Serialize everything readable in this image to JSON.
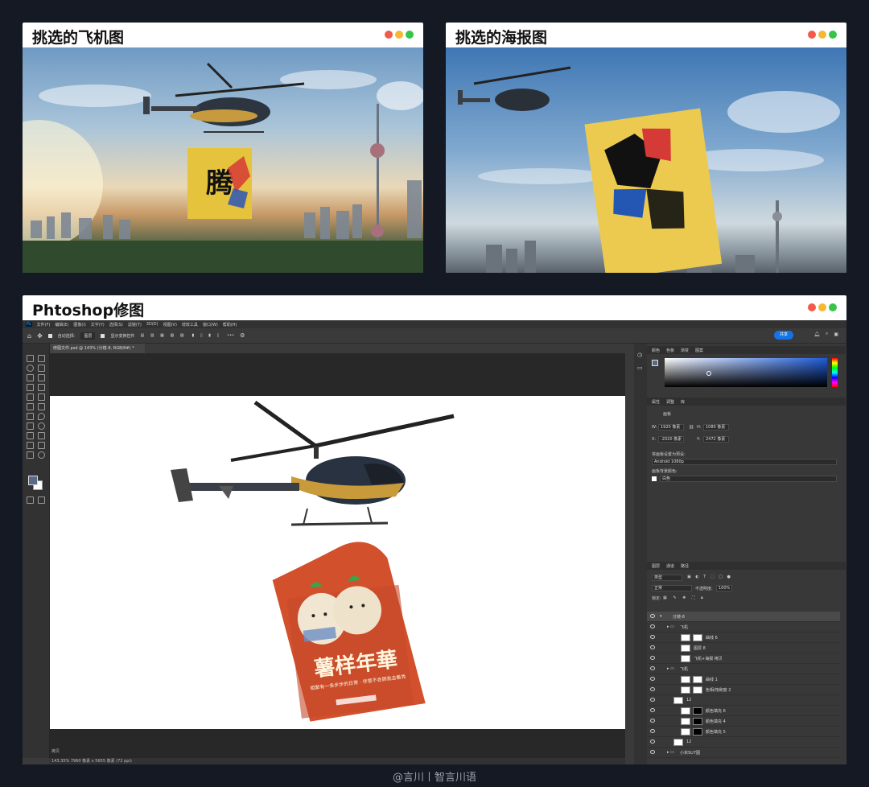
{
  "cards": {
    "heli_title": "挑选的飞机图",
    "poster_title": "挑选的海报图",
    "ps_title": "Phtoshop修图"
  },
  "window_dot_colors": [
    "#f25a4a",
    "#f6b731",
    "#37c44a"
  ],
  "poster_artwork": {
    "headline": "薯样年華",
    "subline": "相聚有一条步步的日常 · 伴意不会顾我去看秀"
  },
  "ps": {
    "menu": [
      "Ps",
      "文件(F)",
      "编辑(E)",
      "图像(I)",
      "文字(Y)",
      "选择(S)",
      "滤镜(T)",
      "3D(D)",
      "视图(V)",
      "增效工具",
      "窗口(W)",
      "帮助(H)"
    ],
    "options": {
      "auto_select": "自动选择:",
      "layer_select": "图层",
      "transform_controls": "显示变换控件"
    },
    "share_label": "共享",
    "doc_tab": "修图文件.psd @ 143% (分镜-8, RGB/8#) *",
    "status_left": "143.35%   7960 像素 x 5655 像素 (72 ppi)",
    "bottom_label": "拷贝",
    "color_panel_tabs": [
      "颜色",
      "色板",
      "渐变",
      "图案"
    ],
    "props_tabs": [
      "属性",
      "调整",
      "库"
    ],
    "props": {
      "artboard_label": "画板",
      "w_label": "W:",
      "w_value": "1920 像素",
      "h_label": "H:",
      "h_value": "1080 像素",
      "x_label": "X:",
      "x_value": "-2020 像素",
      "y_label": "Y:",
      "y_value": "2472 像素",
      "preset_label": "将画板设置为预设:",
      "preset_value": "Android 1080p",
      "bg_label": "画板背景颜色:",
      "bg_value": "白色"
    },
    "layers_tabs": [
      "图层",
      "通道",
      "路径"
    ],
    "layers_filter": "类型",
    "blend_mode": "正常",
    "opacity_label": "不透明度:",
    "opacity_value": "100%",
    "lock_label": "锁定:",
    "layers": [
      {
        "name": "分镜-8",
        "indent": 0,
        "kind": "artboard"
      },
      {
        "name": "飞机",
        "indent": 1,
        "kind": "folder"
      },
      {
        "name": "曲线 6",
        "indent": 2,
        "kind": "adjust"
      },
      {
        "name": "图层 8",
        "indent": 2,
        "kind": "layer"
      },
      {
        "name": "飞机+海报 拷贝",
        "indent": 2,
        "kind": "layer"
      },
      {
        "name": "飞机",
        "indent": 1,
        "kind": "folder"
      },
      {
        "name": "曲线 1",
        "indent": 2,
        "kind": "adjust"
      },
      {
        "name": "色相/饱和度 2",
        "indent": 2,
        "kind": "adjust"
      },
      {
        "name": "12",
        "indent": 1,
        "kind": "layer"
      },
      {
        "name": "颜色填充 6",
        "indent": 2,
        "kind": "fill"
      },
      {
        "name": "颜色填充 4",
        "indent": 2,
        "kind": "fill"
      },
      {
        "name": "颜色填充 5",
        "indent": 2,
        "kind": "fill"
      },
      {
        "name": "12",
        "indent": 1,
        "kind": "layer"
      },
      {
        "name": "小米SU7图",
        "indent": 1,
        "kind": "folder"
      }
    ]
  },
  "watermark": "@言川丨智言川语"
}
